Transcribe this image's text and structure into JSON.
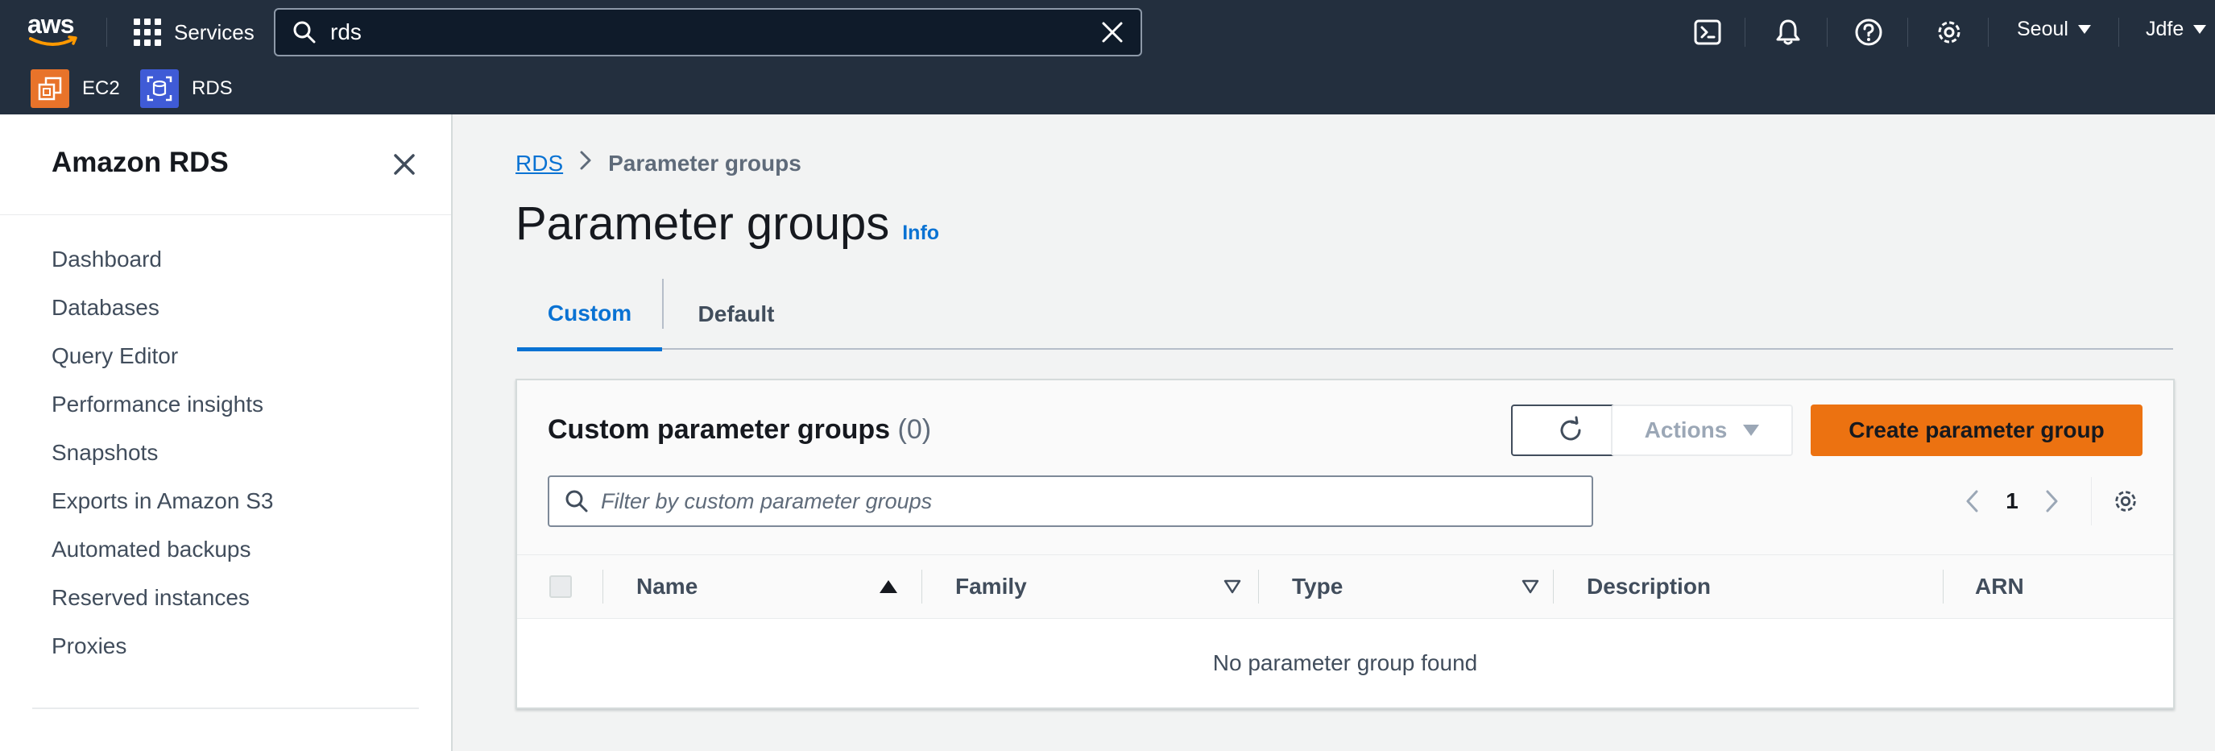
{
  "colors": {
    "nav_bg": "#232f3e",
    "accent_blue": "#0972d3",
    "primary_orange": "#ec7211",
    "ec2_orange": "#e8732a",
    "rds_blue": "#3f5bd6"
  },
  "topbar": {
    "logo_text": "aws",
    "services_label": "Services",
    "search": {
      "value": "rds",
      "icon": "search-icon",
      "clear_icon": "close-icon"
    },
    "icons": [
      "cloudshell-icon",
      "bell-icon",
      "help-icon",
      "gear-icon"
    ],
    "region": "Seoul",
    "account": "Jdfe"
  },
  "favorites": [
    {
      "label": "EC2",
      "icon": "ec2-service-icon"
    },
    {
      "label": "RDS",
      "icon": "rds-service-icon"
    }
  ],
  "sidebar": {
    "title": "Amazon RDS",
    "items": [
      {
        "label": "Dashboard"
      },
      {
        "label": "Databases"
      },
      {
        "label": "Query Editor"
      },
      {
        "label": "Performance insights"
      },
      {
        "label": "Snapshots"
      },
      {
        "label": "Exports in Amazon S3"
      },
      {
        "label": "Automated backups"
      },
      {
        "label": "Reserved instances"
      },
      {
        "label": "Proxies"
      }
    ]
  },
  "breadcrumb": {
    "root": "RDS",
    "current": "Parameter groups"
  },
  "page": {
    "title": "Parameter groups",
    "info": "Info"
  },
  "tabs": [
    {
      "label": "Custom",
      "active": true
    },
    {
      "label": "Default",
      "active": false
    }
  ],
  "container": {
    "title": "Custom parameter groups",
    "count": "(0)",
    "actions_label": "Actions",
    "create_label": "Create parameter group",
    "filter_placeholder": "Filter by custom parameter groups",
    "page_number": "1",
    "columns": [
      {
        "label": "Name",
        "sort": "ascending"
      },
      {
        "label": "Family",
        "sort": "none"
      },
      {
        "label": "Type",
        "sort": "none"
      },
      {
        "label": "Description"
      },
      {
        "label": "ARN"
      }
    ],
    "empty_text": "No parameter group found"
  }
}
